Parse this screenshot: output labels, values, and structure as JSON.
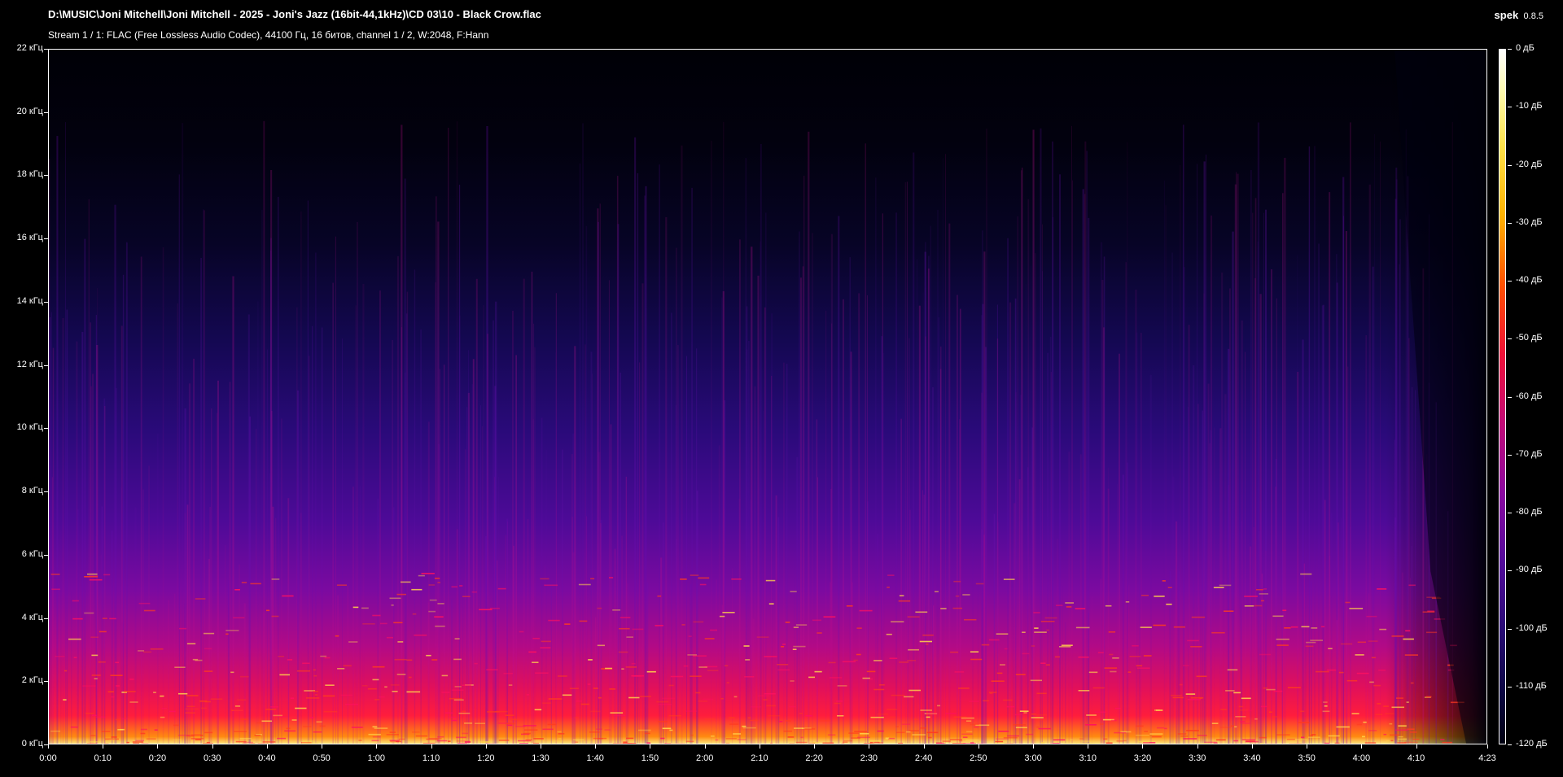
{
  "header": {
    "file_path": "D:\\MUSIC\\Joni Mitchell\\Joni Mitchell - 2025 - Joni's Jazz (16bit-44,1kHz)\\CD 03\\10 - Black Crow.flac",
    "stream_info": "Stream 1 / 1: FLAC (Free Lossless Audio Codec), 44100 Гц, 16 битов, channel 1 / 2, W:2048, F:Hann",
    "app_name": "spek",
    "app_version": "0.8.5"
  },
  "freq_axis": {
    "labels": [
      "22 кГц",
      "20 кГц",
      "18 кГц",
      "16 кГц",
      "14 кГц",
      "12 кГц",
      "10 кГц",
      "8 кГц",
      "6 кГц",
      "4 кГц",
      "2 кГц",
      "0 кГц"
    ],
    "values_khz": [
      22,
      20,
      18,
      16,
      14,
      12,
      10,
      8,
      6,
      4,
      2,
      0
    ],
    "max_khz": 22
  },
  "time_axis": {
    "labels": [
      "0:00",
      "0:10",
      "0:20",
      "0:30",
      "0:40",
      "0:50",
      "1:00",
      "1:10",
      "1:20",
      "1:30",
      "1:40",
      "1:50",
      "2:00",
      "2:10",
      "2:20",
      "2:30",
      "2:40",
      "2:50",
      "3:00",
      "3:10",
      "3:20",
      "3:30",
      "3:40",
      "3:50",
      "4:00",
      "4:10",
      "4:23"
    ],
    "values_sec": [
      0,
      10,
      20,
      30,
      40,
      50,
      60,
      70,
      80,
      90,
      100,
      110,
      120,
      130,
      140,
      150,
      160,
      170,
      180,
      190,
      200,
      210,
      220,
      230,
      240,
      250,
      263
    ],
    "duration_sec": 263
  },
  "db_scale": {
    "labels": [
      "0 дБ",
      "-10 дБ",
      "-20 дБ",
      "-30 дБ",
      "-40 дБ",
      "-50 дБ",
      "-60 дБ",
      "-70 дБ",
      "-80 дБ",
      "-90 дБ",
      "-100 дБ",
      "-110 дБ",
      "-120 дБ"
    ],
    "values_db": [
      0,
      -10,
      -20,
      -30,
      -40,
      -50,
      -60,
      -70,
      -80,
      -90,
      -100,
      -110,
      -120
    ],
    "min_db": -120
  },
  "colors": {
    "background": "#000000",
    "text": "#ffffff",
    "spectrogram_peak": "#fce37a",
    "spectrogram_high": "#ff1d3c",
    "spectrogram_mid": "#b20a86",
    "spectrogram_low": "#2a0a7a"
  }
}
